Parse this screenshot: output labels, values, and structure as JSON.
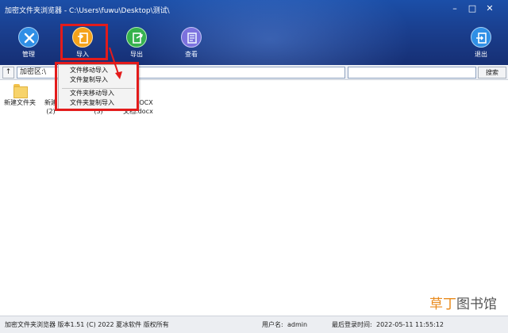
{
  "window": {
    "title": "加密文件夹浏览器 - C:\\Users\\fuwu\\Desktop\\测试\\"
  },
  "toolbar": {
    "manage_label": "管理",
    "import_label": "导入",
    "export_label": "导出",
    "view_label": "查看",
    "exit_label": "退出"
  },
  "addressbar": {
    "up_label": "↑",
    "path": "加密区:\\",
    "search_label": "搜索"
  },
  "context_menu": {
    "items": [
      "文件移动导入",
      "文件复制导入",
      "文件夹移动导入",
      "文件夹复制导入"
    ]
  },
  "files": {
    "items": [
      {
        "line1": "新建文件夹",
        "line2": ""
      },
      {
        "line1": "新建",
        "line2": "(2)"
      },
      {
        "line1": "",
        "line2": "(3)"
      },
      {
        "line1": "OCX",
        "line2": "文档.docx"
      }
    ]
  },
  "statusbar": {
    "left": "加密文件夹浏览器 版本1.51 (C) 2022 夏冰软件 版权所有",
    "user_label": "用户名:",
    "user_value": "admin",
    "last_login_label": "最后登录时间:",
    "last_login_value": "2022-05-11 11:55:12"
  },
  "watermark": {
    "part1": "草丁",
    "part2": "图书馆"
  },
  "colors": {
    "toolbar_blue": "#1a3f8f",
    "highlight_red": "#e31b1b",
    "import_orange": "#f5a21b",
    "export_green": "#35b24a",
    "view_purple": "#7d68d8"
  }
}
